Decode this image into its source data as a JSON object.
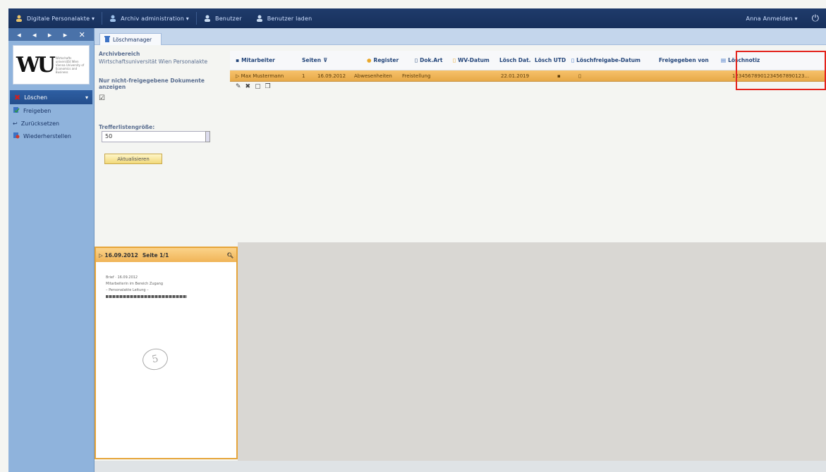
{
  "topbar": {
    "menu1": "Digitale Personalakte ▾",
    "menu2": "Archiv administration ▾",
    "action1": "Benutzer",
    "action2": "Benutzer laden",
    "user": "Anna Anmelden ▾",
    "logout_icon": "power-icon"
  },
  "nav_arrows": [
    "◂",
    "◂",
    "▸",
    "▸",
    "✕"
  ],
  "logo": {
    "mark": "WU",
    "text": "Wirtschafts universität Wien Vienna University of Economics and Business"
  },
  "sidebar": {
    "items": [
      {
        "label": "Löschen",
        "icon": "delete-icon",
        "active": true
      },
      {
        "label": "Freigeben",
        "icon": "release-icon"
      },
      {
        "label": "Zurücksetzen",
        "icon": "reset-icon"
      },
      {
        "label": "Wiederherstellen",
        "icon": "restore-icon"
      }
    ]
  },
  "tab": {
    "label": "Löschmanager"
  },
  "filters": {
    "archive_label": "Archivbereich",
    "archive_value": "Wirtschaftsuniversität Wien Personalakte",
    "only_nonrel_label": "Nur nicht-freigegebene Dokumente anzeigen",
    "checkbox": "☑",
    "pagesize_label": "Trefferlistengröße:",
    "pagesize_value": "50",
    "refresh_button": "Aktualisieren"
  },
  "grid": {
    "columns": [
      "Mitarbeiter",
      "Seiten",
      "Register",
      "Dok.Art",
      "WV-Datum",
      "Lösch Dat.",
      "Lösch UTD",
      "Löschfreigabe-Datum",
      "Freigegeben von",
      "Löschnotiz"
    ],
    "row": {
      "mitarbeiter": "Max Mustermann",
      "seiten": "1",
      "datum": "16.09.2012",
      "register": "Abwesenheiten",
      "dokart": "Freistellung",
      "loeschdat": "22.01.2019",
      "freigabe": "",
      "freigegeben_von": "",
      "notiz": "12345678901234567890123..."
    }
  },
  "preview": {
    "date": "16.09.2012",
    "page": "Seite 1/1",
    "lines": [
      "Brief · 16.09.2012",
      "Mitarbeiterin im Bereich Zugang",
      "– Personalakte Leitung –"
    ],
    "stamp": "5"
  },
  "colors": {
    "accent": "#1f3b6b",
    "highlight": "#e3231c",
    "row": "#f0b457"
  }
}
